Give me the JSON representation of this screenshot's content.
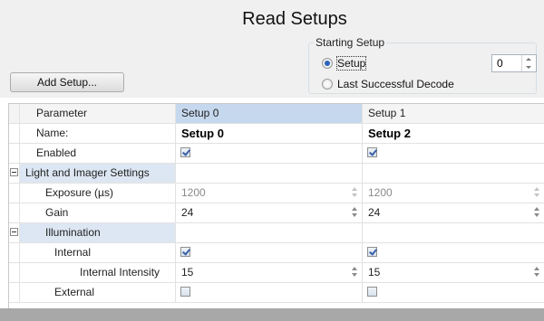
{
  "header": {
    "title": "Read Setups",
    "add_setup_button": "Add Setup..."
  },
  "starting_setup": {
    "group_label": "Starting Setup",
    "options": [
      {
        "label": "Setup",
        "selected": true
      },
      {
        "label": "Last Successful Decode",
        "selected": false
      }
    ],
    "setup_number": "0"
  },
  "grid": {
    "columns": [
      "Parameter",
      "Setup 0",
      "Setup 1"
    ],
    "rows": {
      "name": {
        "label": "Name:",
        "values": [
          "Setup 0",
          "Setup 2"
        ]
      },
      "enabled": {
        "label": "Enabled",
        "values": [
          true,
          true
        ]
      },
      "light_category": {
        "label": "Light and Imager Settings"
      },
      "exposure": {
        "label": "Exposure (µs)",
        "values": [
          "1200",
          "1200"
        ]
      },
      "gain": {
        "label": "Gain",
        "values": [
          "24",
          "24"
        ]
      },
      "illumination_category": {
        "label": "Illumination"
      },
      "internal": {
        "label": "Internal",
        "values": [
          true,
          true
        ]
      },
      "internal_intensity": {
        "label": "Internal Intensity",
        "values": [
          "15",
          "15"
        ]
      },
      "external": {
        "label": "External",
        "values": [
          false,
          false
        ]
      }
    }
  },
  "colors": {
    "selected_header": "#c6d8ee",
    "category_background": "#dde7f3",
    "panel_background": "#f0f0f0"
  }
}
